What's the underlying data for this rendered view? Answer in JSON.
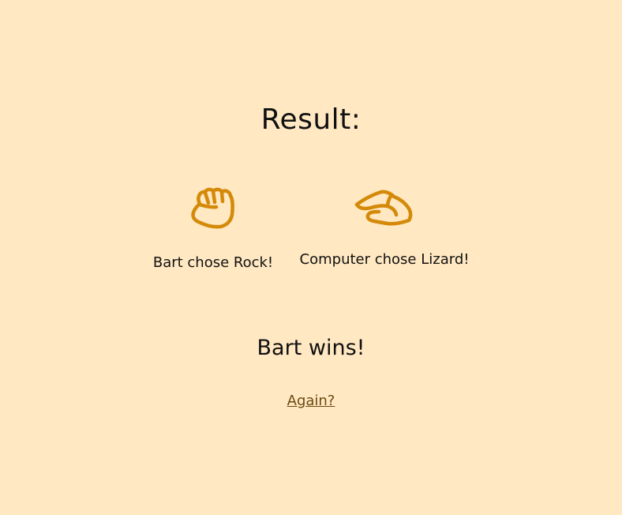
{
  "result": {
    "title": "Result:"
  },
  "player": {
    "icon": "rock-hand-icon",
    "label": "Bart chose Rock!"
  },
  "computer": {
    "icon": "lizard-hand-icon",
    "label": "Computer chose Lizard!"
  },
  "outcome": {
    "text": "Bart wins!"
  },
  "again": {
    "label": "Again?"
  },
  "colors": {
    "background": "#ffe8c2",
    "icon": "#d48a08",
    "link": "#6b4a10"
  }
}
